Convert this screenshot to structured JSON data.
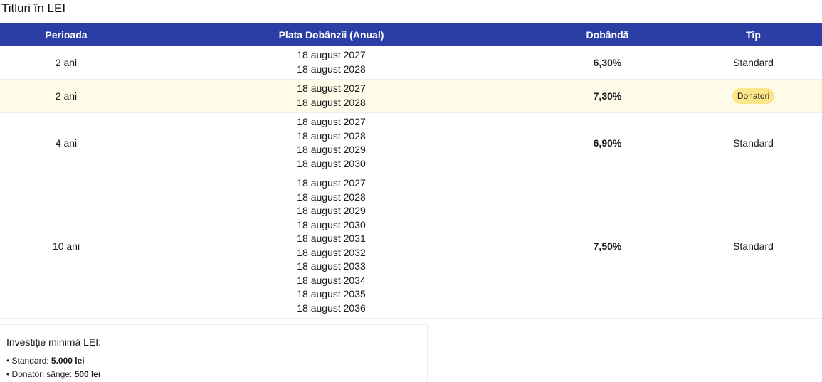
{
  "page": {
    "title": "Titluri în LEI"
  },
  "table": {
    "headers": [
      "Perioada",
      "Plata Dobânzii (Anual)",
      "Dobândă",
      "Tip"
    ],
    "rows": [
      {
        "period": "2 ani",
        "dates": [
          "18 august 2027",
          "18 august 2028"
        ],
        "rate": "6,30%",
        "type": "Standard",
        "badge": false
      },
      {
        "period": "2 ani",
        "dates": [
          "18 august 2027",
          "18 august 2028"
        ],
        "rate": "7,30%",
        "type": "Donatori",
        "badge": true
      },
      {
        "period": "4 ani",
        "dates": [
          "18 august 2027",
          "18 august 2028",
          "18 august 2029",
          "18 august 2030"
        ],
        "rate": "6,90%",
        "type": "Standard",
        "badge": false
      },
      {
        "period": "10 ani",
        "dates": [
          "18 august 2027",
          "18 august 2028",
          "18 august 2029",
          "18 august 2030",
          "18 august 2031",
          "18 august 2032",
          "18 august 2033",
          "18 august 2034",
          "18 august 2035",
          "18 august 2036"
        ],
        "rate": "7,50%",
        "type": "Standard",
        "badge": false
      }
    ]
  },
  "info": {
    "title": "Investiție minimă LEI:",
    "items": [
      {
        "label": "• Standard: ",
        "value": "5.000 lei"
      },
      {
        "label": "• Donatori sânge: ",
        "value": "500 lei"
      }
    ]
  },
  "colors": {
    "header_bg": "#2a3ea6",
    "highlight_row": "#fffbe8",
    "badge_bg": "#fde68a"
  }
}
